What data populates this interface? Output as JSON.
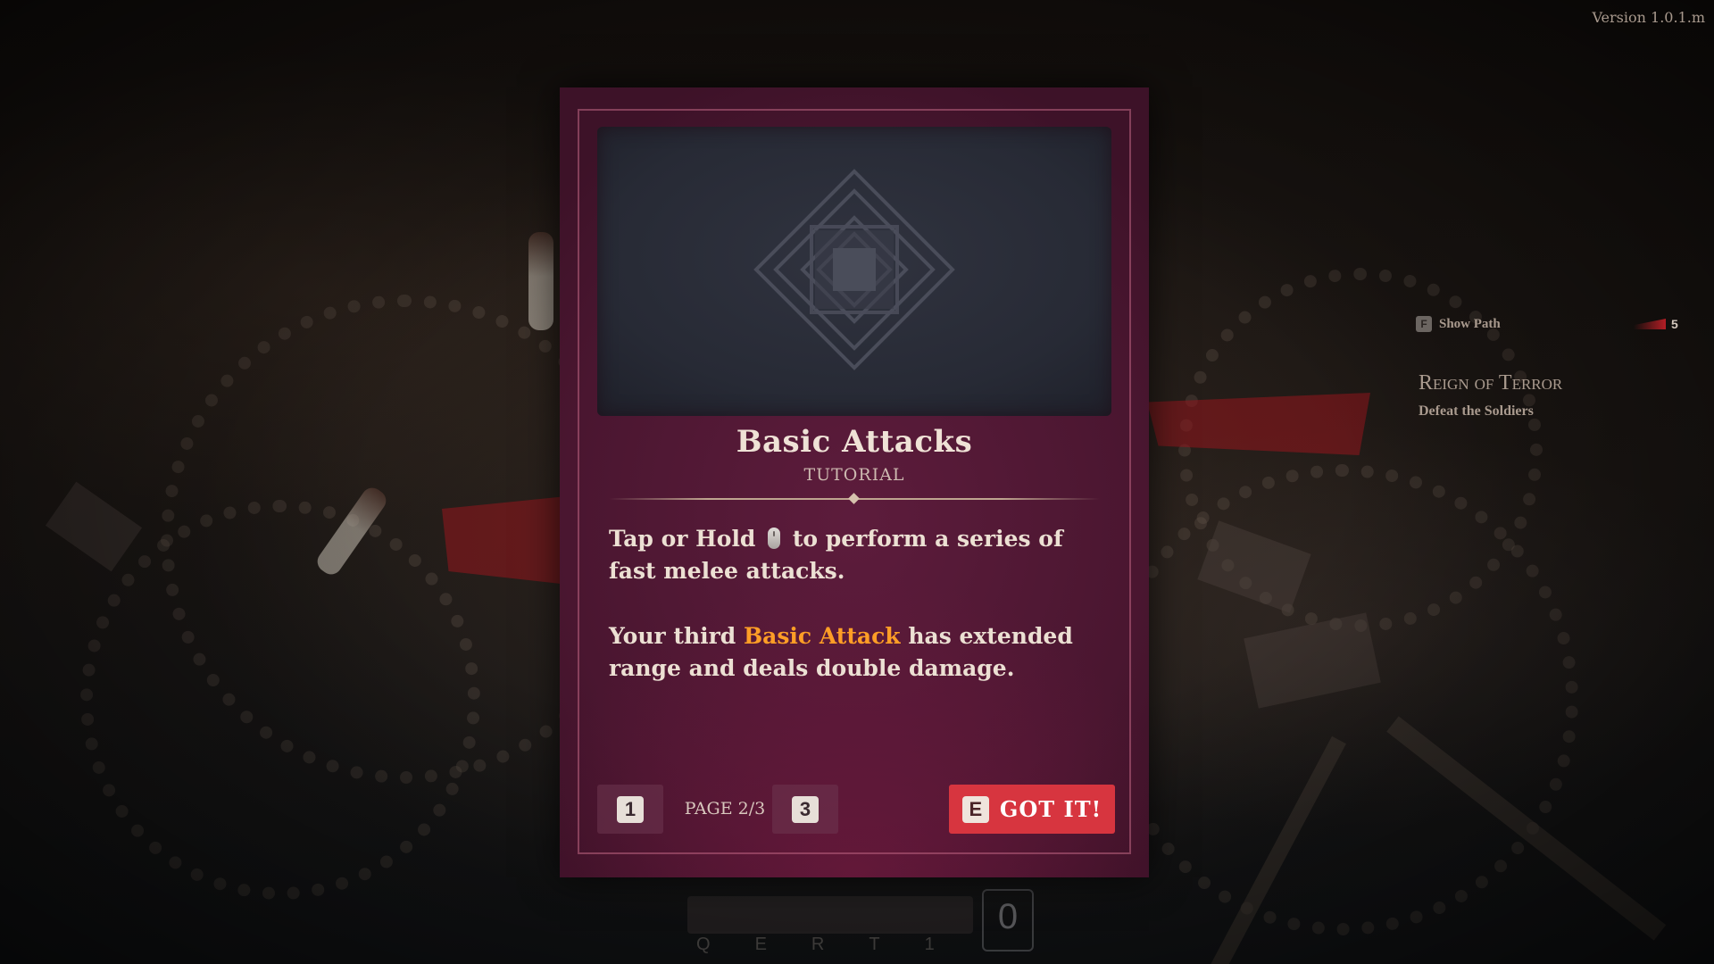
{
  "hud": {
    "version": "Version 1.0.1.m",
    "show_path_key": "F",
    "show_path_label": "Show Path",
    "counter_value": "5",
    "quest_title": "Reign of Terror",
    "quest_objective": "Defeat the Soldiers"
  },
  "hotbar": {
    "keys": [
      "Q",
      "E",
      "R",
      "T",
      "1"
    ],
    "slot_value": "0"
  },
  "tutorial": {
    "title": "Basic Attacks",
    "subtitle": "TUTORIAL",
    "para1_before": "Tap or Hold",
    "para1_after": "to perform a series of fast melee attacks.",
    "para2_before": "Your third",
    "para2_highlight": "Basic Attack",
    "para2_after": "has extended range and deals double damage.",
    "prev_page_key": "1",
    "page_indicator": "PAGE 2/3",
    "next_page_key": "3",
    "confirm_key": "E",
    "confirm_label": "GOT IT!"
  },
  "colors": {
    "card_bg": "#4a1630",
    "card_frame": "#be6482",
    "art_bg": "#2c2f3a",
    "highlight": "#ff9e26",
    "confirm_button": "#d7353f"
  },
  "icons": {
    "card_art": "concentric-diamond-emblem-icon",
    "mouse": "mouse-left-click-icon"
  }
}
